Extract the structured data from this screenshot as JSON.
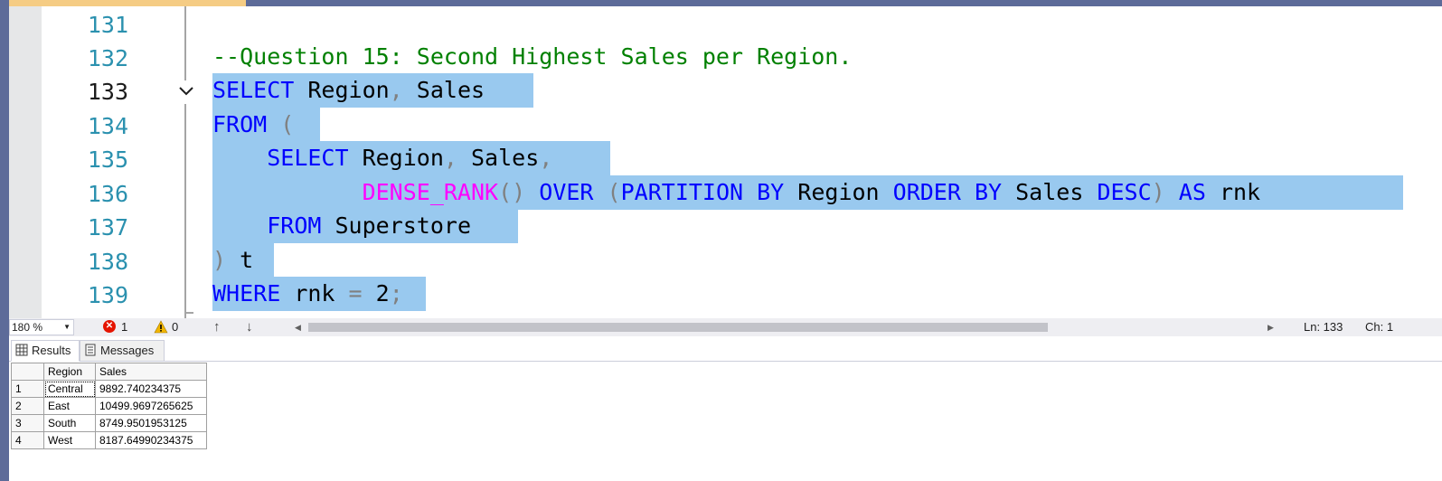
{
  "editor": {
    "lines": [
      {
        "number": "131",
        "text": ""
      },
      {
        "number": "132",
        "text": "--Question 15: Second Highest Sales per Region."
      },
      {
        "number": "133",
        "text": "SELECT Region, Sales"
      },
      {
        "number": "134",
        "text": "FROM ("
      },
      {
        "number": "135",
        "text": "    SELECT Region, Sales,"
      },
      {
        "number": "136",
        "text": "           DENSE_RANK() OVER (PARTITION BY Region ORDER BY Sales DESC) AS rnk"
      },
      {
        "number": "137",
        "text": "    FROM Superstore"
      },
      {
        "number": "138",
        "text": ") t"
      },
      {
        "number": "139",
        "text": "WHERE rnk = 2;"
      }
    ],
    "current_line": "133"
  },
  "status_bar": {
    "zoom": "180 %",
    "errors": "1",
    "warnings": "0",
    "line": "Ln: 133",
    "char": "Ch: 1"
  },
  "results": {
    "tabs": [
      {
        "label": "Results",
        "icon": "grid-icon",
        "active": true
      },
      {
        "label": "Messages",
        "icon": "messages-icon",
        "active": false
      }
    ],
    "columns": [
      "Region",
      "Sales"
    ],
    "rows": [
      {
        "num": "1",
        "region": "Central",
        "sales": "9892.740234375"
      },
      {
        "num": "2",
        "region": "East",
        "sales": "10499.9697265625"
      },
      {
        "num": "3",
        "region": "South",
        "sales": "8749.9501953125"
      },
      {
        "num": "4",
        "region": "West",
        "sales": "8187.64990234375"
      }
    ]
  },
  "colors": {
    "keyword": "#0000ff",
    "function": "#ff00ff",
    "comment": "#008000",
    "operator": "#808080",
    "selection": "#99c9ef",
    "line_number": "#2b91af"
  }
}
